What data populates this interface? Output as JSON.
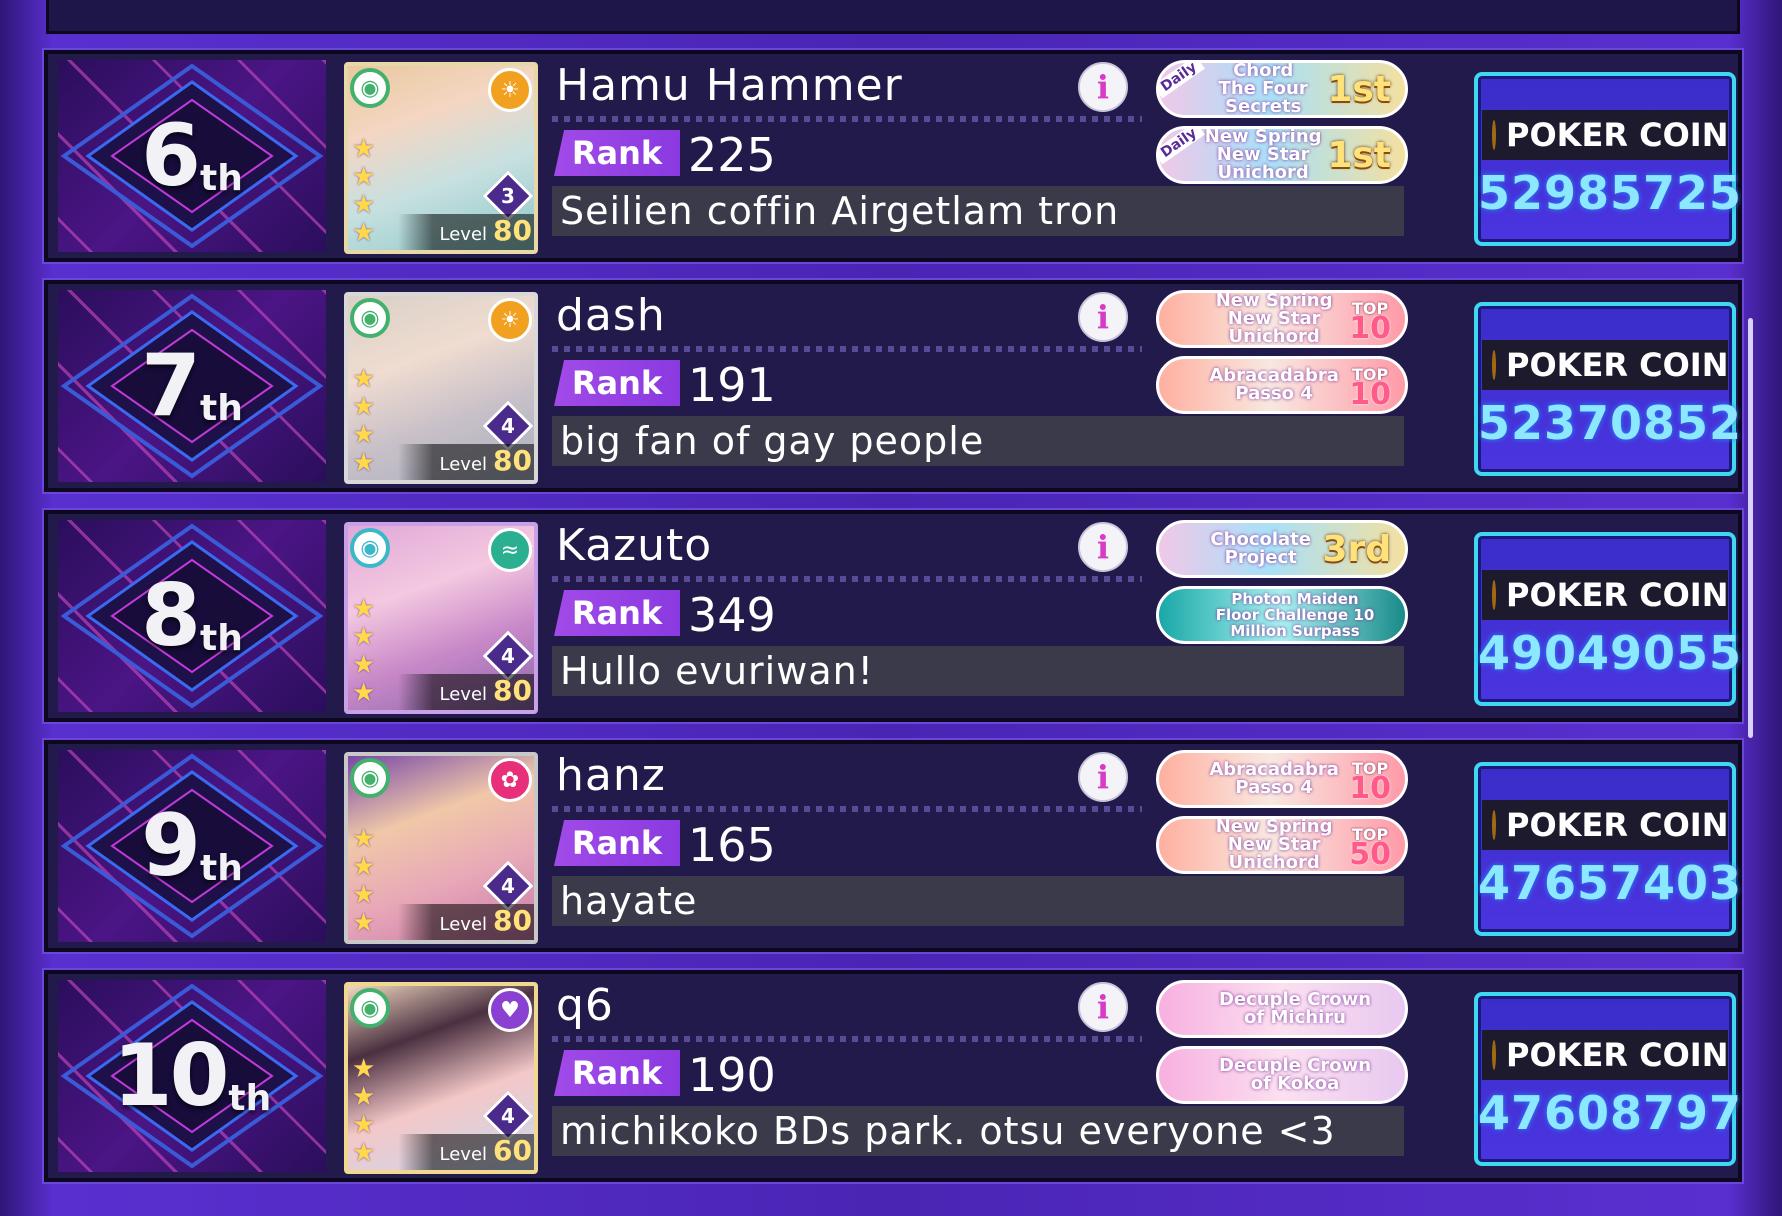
{
  "header": {
    "coin_label": "POKER COIN",
    "rank_label": "Rank",
    "level_label": "Level"
  },
  "colors": {
    "accent": "#a14ae8",
    "coin_value": "#8ce8ff",
    "panel": "#221a4a"
  },
  "rows": [
    {
      "place": "6",
      "suffix": "th",
      "name": "Hamu Hammer",
      "rank": "225",
      "comment": "Seilien coffin Airgetlam tron",
      "level": "80",
      "train": "3",
      "card_attr_icon": "green-attr-icon",
      "card_band_icon": "sun-icon",
      "badges": [
        {
          "tag": "Daily",
          "text": "Chord\nThe Four Secrets",
          "placement": "1st",
          "kind": "placement"
        },
        {
          "tag": "Daily",
          "text": "New Spring New Star\nUnichord",
          "placement": "1st",
          "kind": "placement"
        }
      ],
      "coins": "52985725"
    },
    {
      "place": "7",
      "suffix": "th",
      "name": "dash",
      "rank": "191",
      "comment": "big fan of gay people",
      "level": "80",
      "train": "4",
      "card_attr_icon": "green-attr-icon",
      "card_band_icon": "sun-icon",
      "badges": [
        {
          "text": "New Spring New Star\nUnichord",
          "top_label": "TOP",
          "top_value": "10",
          "kind": "top"
        },
        {
          "text": "Abracadabra\nPasso 4",
          "top_label": "TOP",
          "top_value": "10",
          "kind": "top"
        }
      ],
      "coins": "52370852"
    },
    {
      "place": "8",
      "suffix": "th",
      "name": "Kazuto",
      "rank": "349",
      "comment": "Hullo evuriwan!",
      "level": "80",
      "train": "4",
      "card_attr_icon": "teal-attr-icon",
      "card_band_icon": "wave-icon",
      "badges": [
        {
          "text": "Chocolate\nProject",
          "placement": "3rd",
          "kind": "placement"
        },
        {
          "text": "Photon Maiden\nFloor Challenge 10 Million Surpass",
          "kind": "challenge"
        }
      ],
      "coins": "49049055"
    },
    {
      "place": "9",
      "suffix": "th",
      "name": "hanz",
      "rank": "165",
      "comment": "hayate",
      "level": "80",
      "train": "4",
      "card_attr_icon": "green-attr-icon",
      "card_band_icon": "ribbon-icon",
      "badges": [
        {
          "text": "Abracadabra\nPasso 4",
          "top_label": "TOP",
          "top_value": "10",
          "kind": "top"
        },
        {
          "text": "New Spring New Star\nUnichord",
          "top_label": "TOP",
          "top_value": "50",
          "kind": "top"
        }
      ],
      "coins": "47657403"
    },
    {
      "place": "10",
      "suffix": "th",
      "name": "q6",
      "rank": "190",
      "comment": "michikoko BDs park. otsu everyone <3",
      "level": "60",
      "train": "4",
      "card_attr_icon": "green-attr-icon",
      "card_band_icon": "heart-icon",
      "badges": [
        {
          "text": "Decuple Crown\nof Michiru",
          "kind": "crown"
        },
        {
          "text": "Decuple Crown\nof Kokoa",
          "kind": "crown"
        }
      ],
      "coins": "47608797"
    }
  ]
}
